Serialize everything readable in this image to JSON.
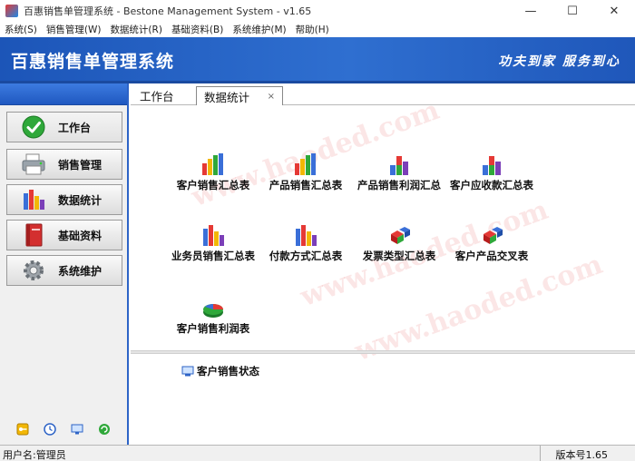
{
  "window": {
    "title": "百惠销售单管理系统 - Bestone Management System - v1.65",
    "minimize": "—",
    "maximize": "☐",
    "close": "✕"
  },
  "menu": [
    {
      "label": "系统(S)"
    },
    {
      "label": "销售管理(W)"
    },
    {
      "label": "数据统计(R)"
    },
    {
      "label": "基础资料(B)"
    },
    {
      "label": "系统维护(M)"
    },
    {
      "label": "帮助(H)"
    }
  ],
  "banner": {
    "title": "百惠销售单管理系统",
    "slogan": "功夫到家 服务到心"
  },
  "sidebar": {
    "items": [
      {
        "label": "工作台",
        "icon": "check-circle-icon",
        "active": true
      },
      {
        "label": "销售管理",
        "icon": "printer-icon"
      },
      {
        "label": "数据统计",
        "icon": "bar-chart-icon"
      },
      {
        "label": "基础资料",
        "icon": "book-icon"
      },
      {
        "label": "系统维护",
        "icon": "gear-icon"
      }
    ],
    "bottom_icons": [
      "key-icon",
      "clock-icon",
      "monitor-icon",
      "refresh-icon"
    ]
  },
  "tabs": [
    {
      "label": "工作台"
    },
    {
      "label": "数据统计",
      "active": true,
      "close": "×"
    }
  ],
  "reports": [
    {
      "label": "客户销售汇总表",
      "icon": "bar-chart-icon"
    },
    {
      "label": "产品销售汇总表",
      "icon": "bar-chart-icon"
    },
    {
      "label": "产品销售利润汇总",
      "icon": "stack-chart-icon"
    },
    {
      "label": "客户应收款汇总表",
      "icon": "stack-chart-icon"
    },
    {
      "label": "业务员销售汇总表",
      "icon": "bar-chart-icon"
    },
    {
      "label": "付款方式汇总表",
      "icon": "bar-chart-icon"
    },
    {
      "label": "发票类型汇总表",
      "icon": "cubes-icon"
    },
    {
      "label": "客户产品交叉表",
      "icon": "cubes-icon"
    },
    {
      "label": "客户销售利润表",
      "icon": "pie-chart-icon"
    }
  ],
  "lower": {
    "item": "客户销售状态"
  },
  "status": {
    "user": "用户名:管理员",
    "version": "版本号1.65"
  },
  "watermark": "www.haoded.com",
  "colors": {
    "banner": "#2f6fd0",
    "accent_border": "#2d63c6"
  }
}
